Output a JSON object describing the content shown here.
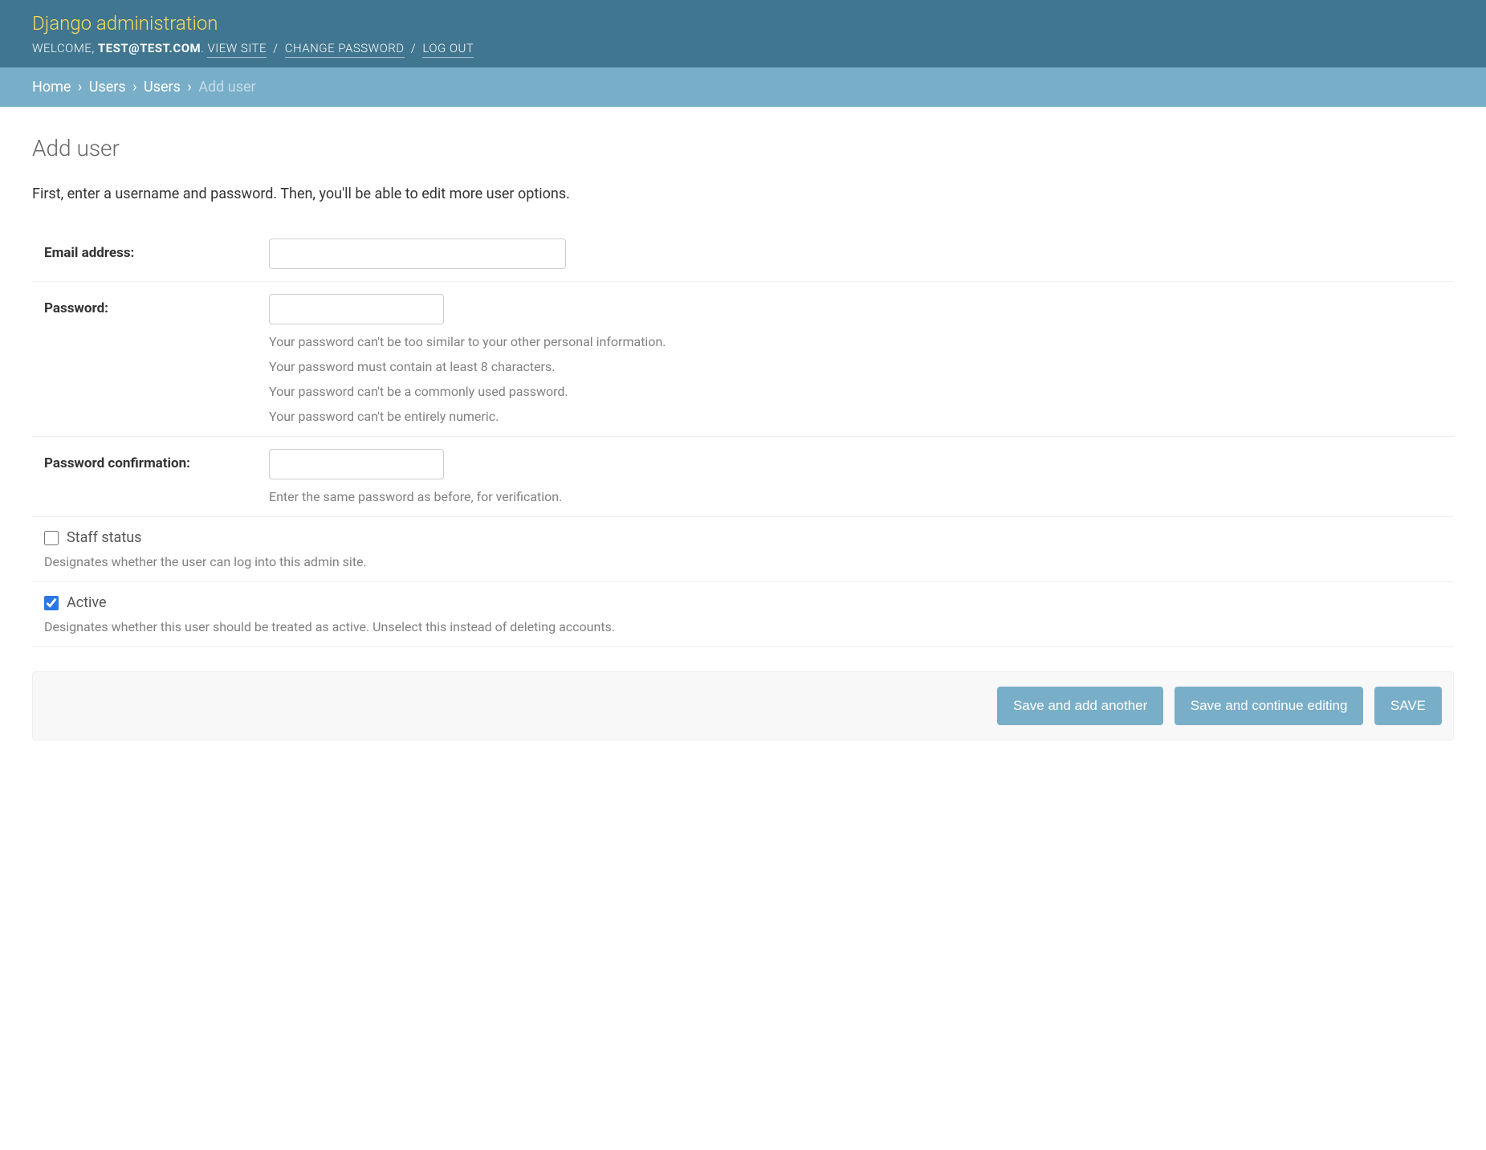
{
  "header": {
    "branding_title": "Django administration",
    "welcome_prefix": "Welcome, ",
    "user_identifier": "TEST@TEST.COM",
    "view_site_label": "View site",
    "change_password_label": "Change password",
    "log_out_label": "Log out"
  },
  "breadcrumbs": {
    "items": [
      "Home",
      "Users",
      "Users"
    ],
    "current": "Add user"
  },
  "page_title": "Add user",
  "intro_text": "First, enter a username and password. Then, you'll be able to edit more user options.",
  "form": {
    "email": {
      "label": "Email address:",
      "value": ""
    },
    "password": {
      "label": "Password:",
      "value": "",
      "help": [
        "Your password can't be too similar to your other personal information.",
        "Your password must contain at least 8 characters.",
        "Your password can't be a commonly used password.",
        "Your password can't be entirely numeric."
      ]
    },
    "password_confirmation": {
      "label": "Password confirmation:",
      "value": "",
      "help": "Enter the same password as before, for verification."
    },
    "staff_status": {
      "label": "Staff status",
      "checked": false,
      "help": "Designates whether the user can log into this admin site."
    },
    "active": {
      "label": "Active",
      "checked": true,
      "help": "Designates whether this user should be treated as active. Unselect this instead of deleting accounts."
    }
  },
  "buttons": {
    "save_add_another": "Save and add another",
    "save_continue": "Save and continue editing",
    "save": "SAVE"
  }
}
